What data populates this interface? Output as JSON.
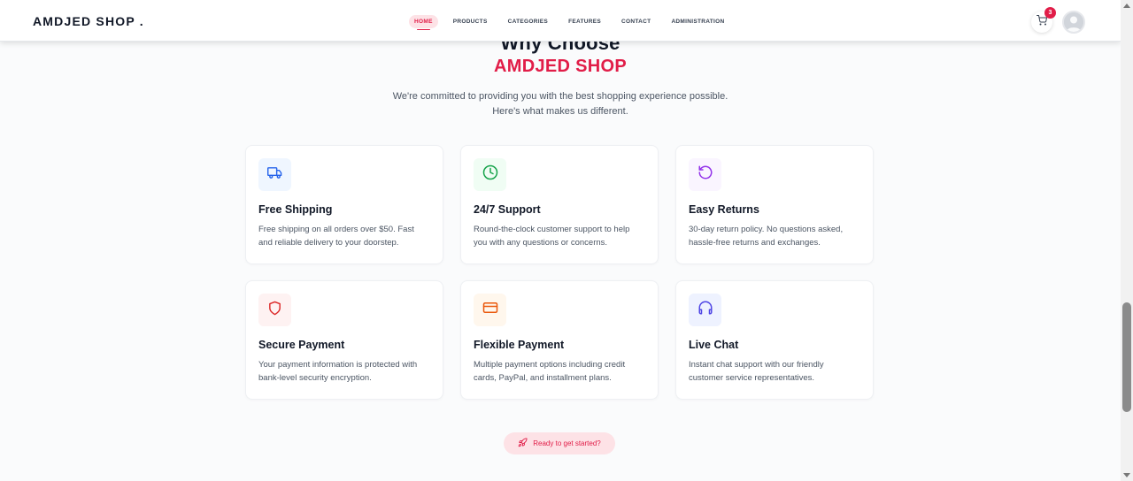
{
  "brand": {
    "logo": "AMDJED SHOP ."
  },
  "nav": {
    "links": [
      {
        "label": "HOME",
        "active": true
      },
      {
        "label": "PRODUCTS"
      },
      {
        "label": "CATEGORIES"
      },
      {
        "label": "FEATURES"
      },
      {
        "label": "CONTACT"
      },
      {
        "label": "ADMINISTRATION"
      }
    ],
    "cart_count": "3",
    "cart_icon": "cart-icon",
    "avatar_icon": "user-avatar-icon"
  },
  "section": {
    "heading": "Why Choose",
    "brand_highlight": "AMDJED SHOP",
    "intro_line1": "We're committed to providing you with the best shopping experience possible.",
    "intro_line2": "Here's what makes us different."
  },
  "features": [
    {
      "icon": "truck-icon",
      "title": "Free Shipping",
      "desc_line1": "Free shipping on all orders over $50. Fast",
      "desc_line2": "and reliable delivery to your doorstep.",
      "color": "#2563eb",
      "bg": "#eff6ff"
    },
    {
      "icon": "clock-icon",
      "title": "24/7 Support",
      "desc_line1": "Round-the-clock customer support to help",
      "desc_line2": "you with any questions or concerns.",
      "color": "#16a34a",
      "bg": "#f0fdf4"
    },
    {
      "icon": "rotate-ccw-icon",
      "title": "Easy Returns",
      "desc_line1": "30-day return policy. No questions asked,",
      "desc_line2": "hassle-free returns and exchanges.",
      "color": "#9333ea",
      "bg": "#faf5ff"
    },
    {
      "icon": "shield-icon",
      "title": "Secure Payment",
      "desc_line1": "Your payment information is protected with",
      "desc_line2": "bank-level security encryption.",
      "color": "#dc2626",
      "bg": "#fef2f2"
    },
    {
      "icon": "credit-card-icon",
      "title": "Flexible Payment",
      "desc_line1": "Multiple payment options including credit",
      "desc_line2": "cards, PayPal, and installment plans.",
      "color": "#ea580c",
      "bg": "#fff7ed"
    },
    {
      "icon": "headphones-icon",
      "title": "Live Chat",
      "desc_line1": "Instant chat support with our friendly",
      "desc_line2": "customer service representatives.",
      "color": "#4f46e5",
      "bg": "#eef2ff"
    }
  ],
  "cta": {
    "label": "Ready to get started?",
    "icon": "rocket-icon"
  },
  "colors": {
    "accent": "#e11d48",
    "accent_soft": "#fde2e6"
  }
}
